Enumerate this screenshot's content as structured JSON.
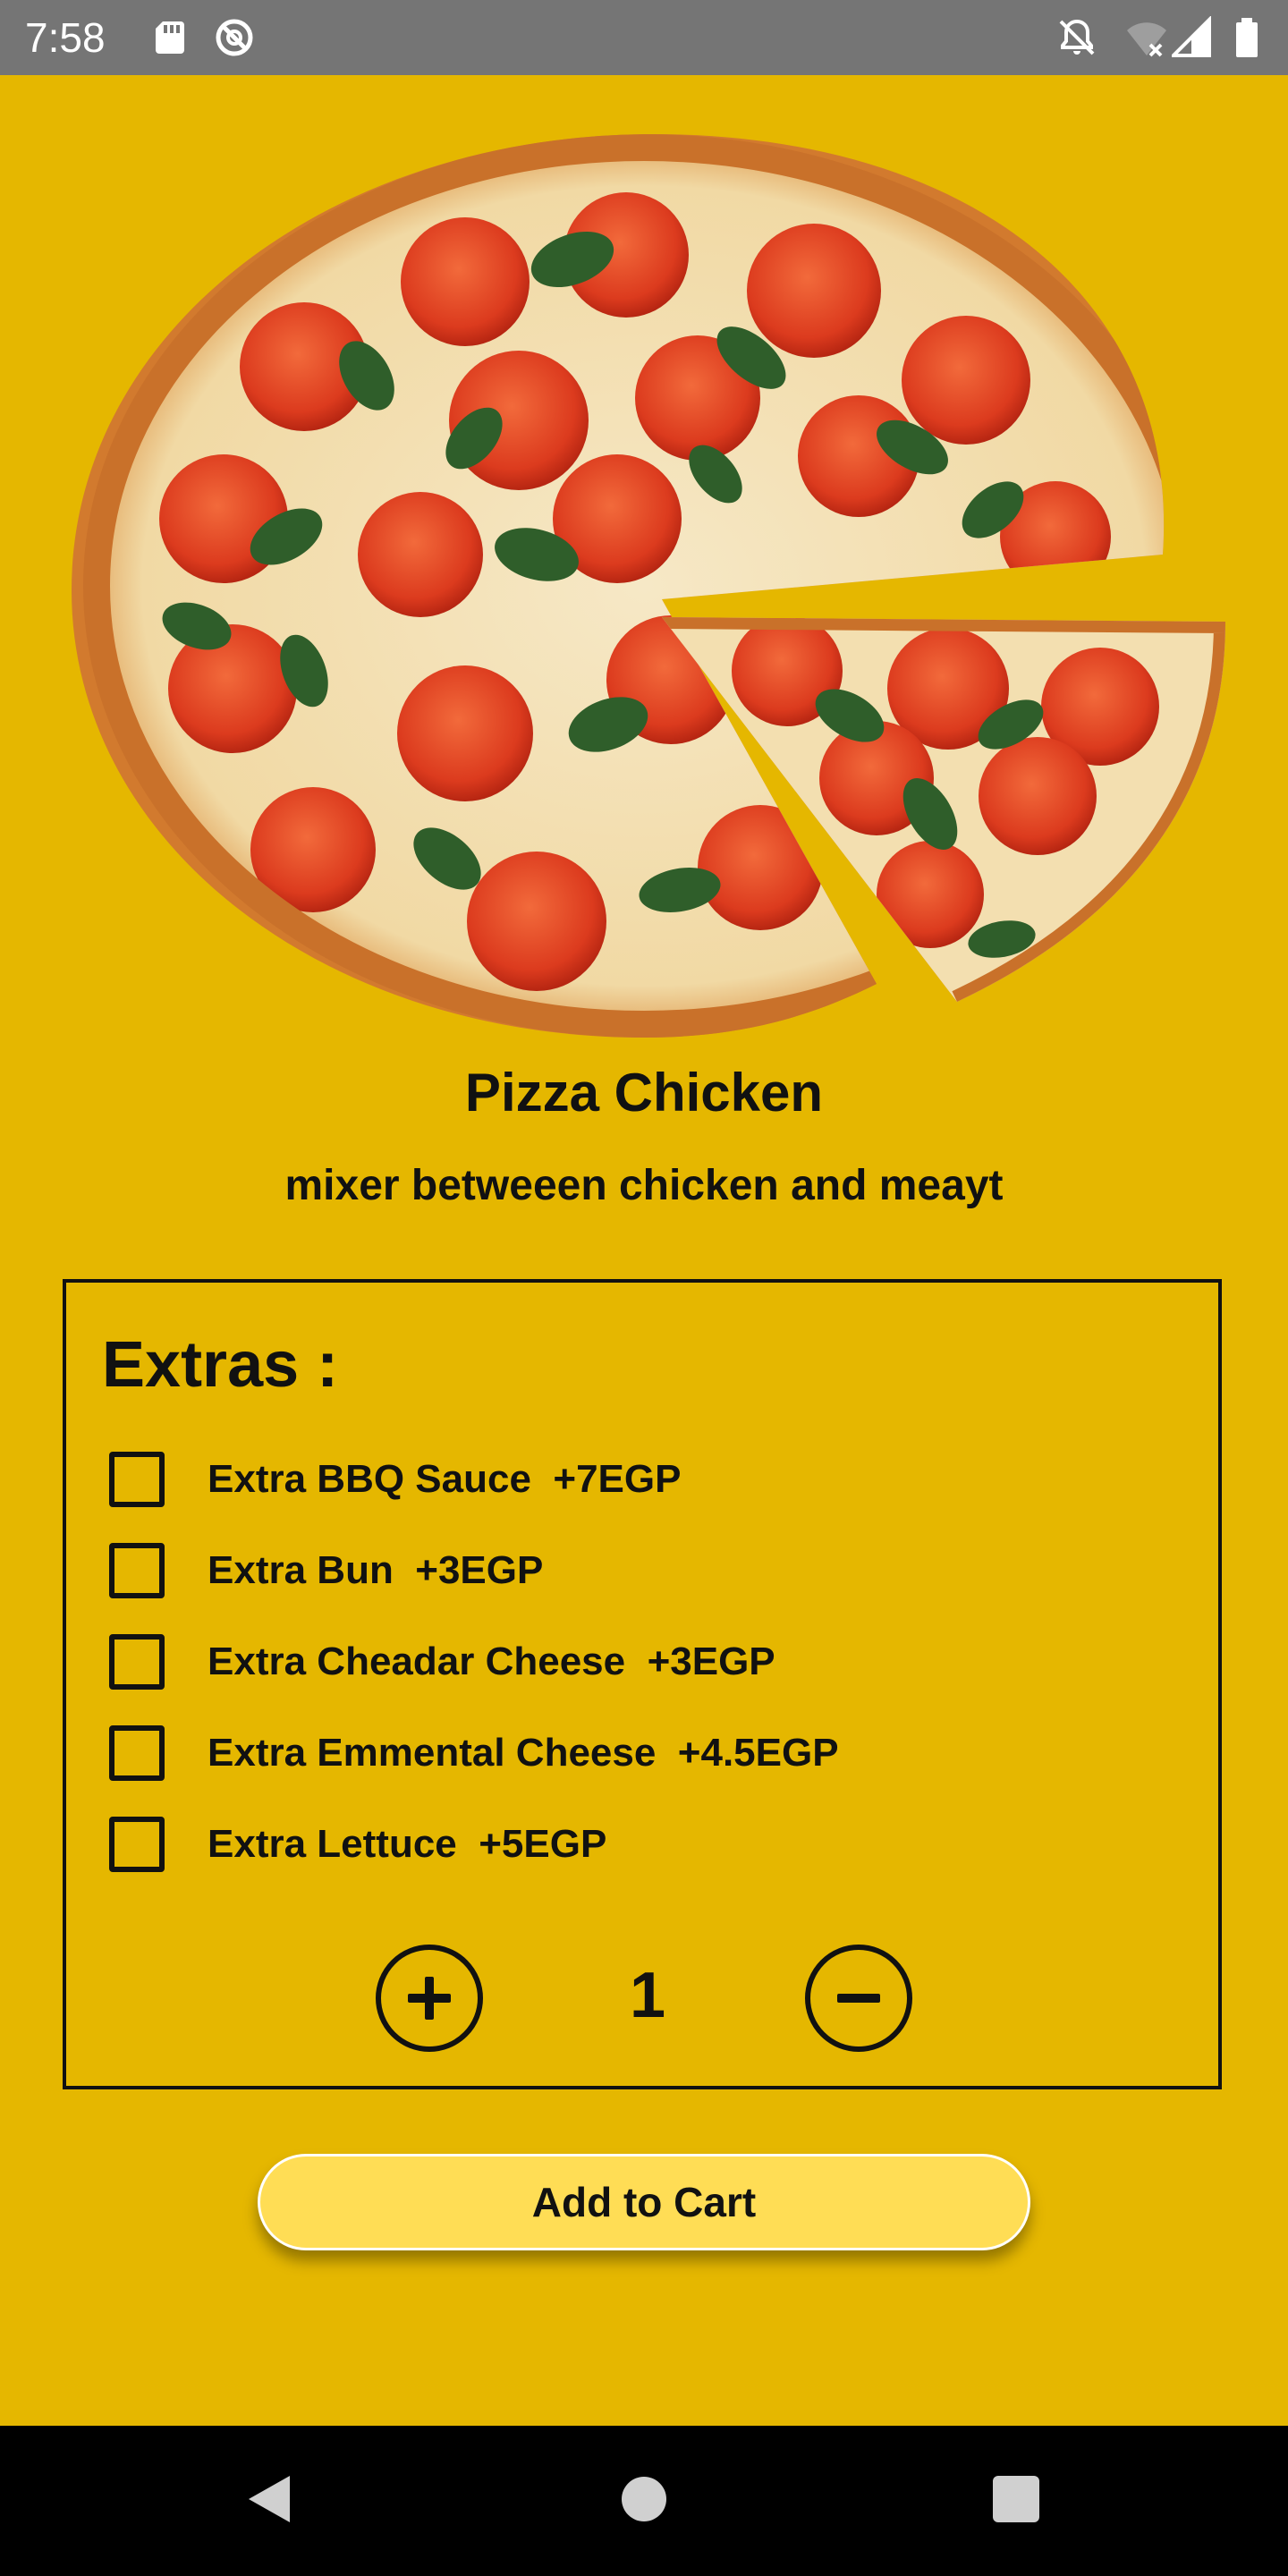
{
  "status_bar": {
    "time": "7:58",
    "left_icons": [
      "sd-card-icon",
      "sync-blocked-icon"
    ],
    "right_icons": [
      "notifications-off-icon",
      "wifi-off-icon",
      "cell-signal-icon",
      "battery-icon"
    ]
  },
  "product": {
    "image": "pizza-image",
    "title": "Pizza Chicken",
    "description": "mixer betweeen chicken and meayt"
  },
  "extras": {
    "heading": "Extras :",
    "items": [
      {
        "label": "Extra BBQ Sauce  +7EGP",
        "checked": false
      },
      {
        "label": "Extra Bun  +3EGP",
        "checked": false
      },
      {
        "label": "Extra Cheadar Cheese  +3EGP",
        "checked": false
      },
      {
        "label": "Extra Emmental Cheese  +4.5EGP",
        "checked": false
      },
      {
        "label": "Extra Lettuce  +5EGP",
        "checked": false
      }
    ],
    "quantity": "1"
  },
  "cart_button": {
    "label": "Add to Cart"
  },
  "nav": {
    "icons": [
      "back-icon",
      "home-icon",
      "recents-icon"
    ]
  },
  "colors": {
    "background": "#E5B700",
    "button": "#FFDD55",
    "text": "#111111",
    "status_bar": "#757575",
    "nav_bar": "#000000"
  }
}
